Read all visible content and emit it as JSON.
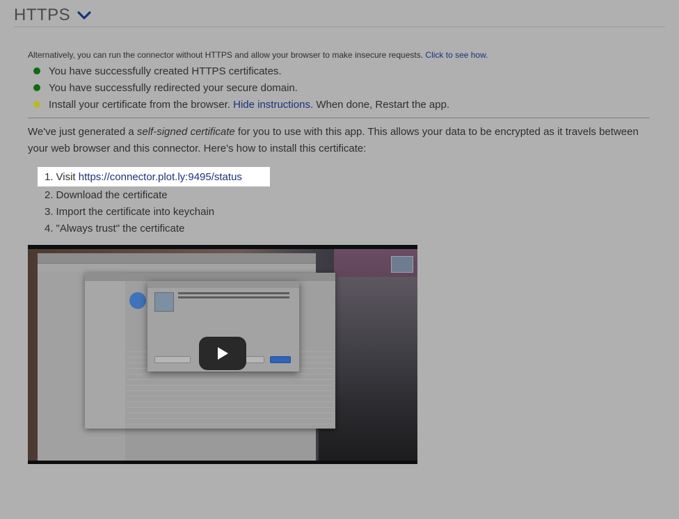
{
  "header": {
    "title": "HTTPS",
    "toggle_icon": "chevron-down-icon"
  },
  "note": {
    "text": "Alternatively, you can run the connector without HTTPS and allow your browser to make insecure requests.",
    "link": "Click to see how."
  },
  "status_items": [
    {
      "text": "You have successfully created HTTPS certificates.",
      "color": "#0f6b10"
    },
    {
      "text": "You have successfully redirected your secure domain.",
      "color": "#0f6b10"
    },
    {
      "text_before": "Install your certificate from the browser.",
      "link": "Hide instructions.",
      "text_after": "When done, Restart the app.",
      "color": "#b8b82a"
    }
  ],
  "intro": {
    "before": "We've just generated a",
    "emphasis": "self-signed certificate",
    "after": "for you to use with this app. This allows your data to be encrypted as it travels between your web browser and this connector. Here's how to install this certificate:"
  },
  "steps": [
    {
      "num": "1.",
      "text": "Visit",
      "link": "https://connector.plot.ly:9495/status"
    },
    {
      "num": "2.",
      "text": "Download the certificate"
    },
    {
      "num": "3.",
      "text": "Import the certificate into keychain"
    },
    {
      "num": "4.",
      "text": "\"Always trust\" the certificate"
    }
  ],
  "video": {
    "play_icon": "play-icon"
  },
  "colors": {
    "overlay_bg": "#b0b0b0",
    "link": "#17337a",
    "highlight": "#ffffff"
  }
}
